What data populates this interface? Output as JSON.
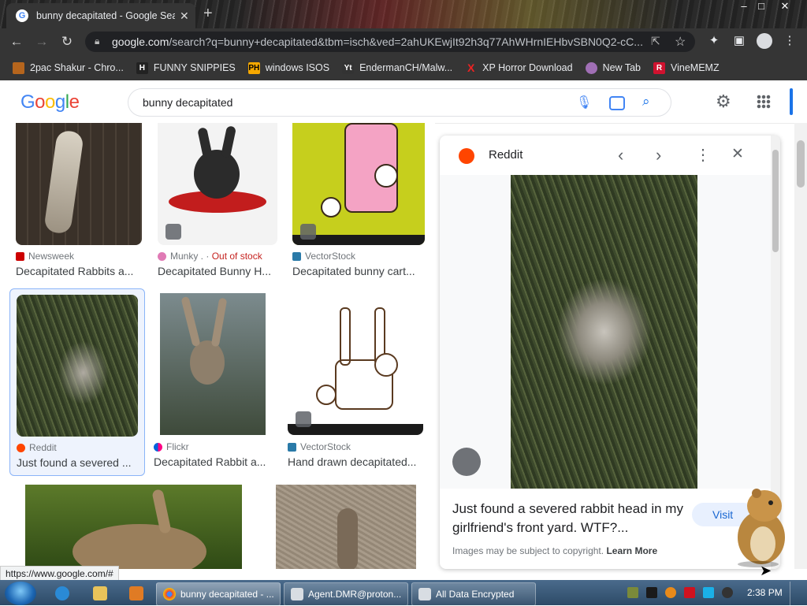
{
  "browser": {
    "tab_title": "bunny decapitated - Google Search",
    "tab_close": "✕",
    "new_tab": "+",
    "url_host": "google.com",
    "url_rest": "/search?q=bunny+decapitated&tbm=isch&ved=2ahUKEwjIt92h3q77AhWHrnIEHbvSBN0Q2-cC...",
    "window_controls": [
      "–",
      "□",
      "✕"
    ]
  },
  "bookmarks": [
    {
      "label": "2pac Shakur - Chro...",
      "icon_char": "",
      "color": "#b5651d"
    },
    {
      "label": "FUNNY SNIPPIES",
      "icon_char": "H",
      "color": "#222222"
    },
    {
      "label": "windows ISOS",
      "icon_char": "PH",
      "color": "#f6a800"
    },
    {
      "label": "EndermanCH/Malw...",
      "icon_char": "Yt",
      "color": "#333333"
    },
    {
      "label": "XP Horror Download",
      "icon_char": "X",
      "color": "#cc1111"
    },
    {
      "label": "New Tab",
      "icon_char": "",
      "color": "#a06fb5"
    },
    {
      "label": "VineMEMZ",
      "icon_char": "R",
      "color": "#d0122f"
    }
  ],
  "google": {
    "query": "bunny decapitated",
    "logo_letters": [
      "G",
      "o",
      "o",
      "g",
      "l",
      "e"
    ],
    "logo_colors": [
      "#4285f4",
      "#ea4335",
      "#fbbc05",
      "#4285f4",
      "#34a853",
      "#ea4335"
    ]
  },
  "results": [
    {
      "source": "Newsweek",
      "status": "",
      "caption": "Decapitated Rabbits a...",
      "src_color": "#cc0000"
    },
    {
      "source": "Munky .",
      "status": "Out of stock",
      "caption": "Decapitated Bunny H...",
      "src_color": "#e07ab5"
    },
    {
      "source": "VectorStock",
      "status": "",
      "caption": "Decapitated bunny cart...",
      "src_color": "#2a7aa8"
    },
    {
      "source": "Reddit",
      "status": "",
      "caption": "Just found a severed ...",
      "src_color": "#ff4500"
    },
    {
      "source": "Flickr",
      "status": "",
      "caption": "Decapitated Rabbit a...",
      "src_color": "#0063dc"
    },
    {
      "source": "VectorStock",
      "status": "",
      "caption": "Hand drawn decapitated...",
      "src_color": "#2a7aa8"
    }
  ],
  "panel": {
    "source": "Reddit",
    "title": "Just found a severed rabbit head in my girlfriend's front yard. WTF?...",
    "visit_label": "Visit",
    "copyright": "Images may be subject to copyright.",
    "learn_more": "Learn More"
  },
  "status_url": "https://www.google.com/#",
  "taskbar": {
    "tasks": [
      {
        "label": "bunny decapitated - ...",
        "active": true
      },
      {
        "label": "Agent.DMR@proton...",
        "active": false
      },
      {
        "label": "All Data Encrypted",
        "active": false
      }
    ],
    "clock": "2:38 PM"
  }
}
